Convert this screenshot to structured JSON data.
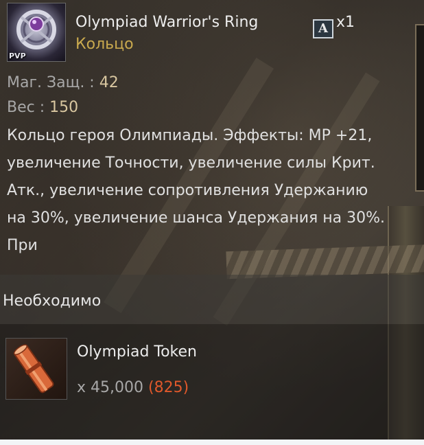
{
  "item": {
    "name": "Olympiad Warrior's Ring",
    "grade": "A",
    "count": "x1",
    "type": "Кольцо",
    "icon": "ring-icon",
    "icon_badge": "PVP"
  },
  "stats": [
    {
      "label": "Маг. Защ. : ",
      "value": "42"
    },
    {
      "label": "Вес : ",
      "value": "150"
    }
  ],
  "description": "Кольцо героя Олимпиады. Эффекты: MP +21, увеличение Точности, увеличение силы Крит. Атк., увеличение сопротивления Удержанию на 30%, увеличение шанса Удержания на 30%. При",
  "requirements": {
    "header": "Необходимо",
    "items": [
      {
        "name": "Olympiad Token",
        "icon": "token-scroll-icon",
        "amount": "x 45,000",
        "owned": "(825)"
      }
    ]
  },
  "colors": {
    "item_type": "#c9a94e",
    "stat_value": "#d9c7a0",
    "owned_insufficient": "#e0582b"
  }
}
